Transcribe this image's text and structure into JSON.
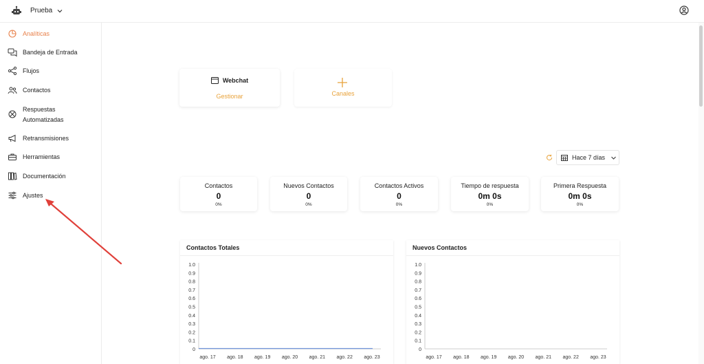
{
  "topbar": {
    "workspace_name": "Prueba",
    "logo_icon": "robot-icon",
    "user_icon": "user-circle-icon"
  },
  "sidebar": {
    "items": [
      {
        "label": "Analíticas",
        "icon": "analytics-icon",
        "active": true
      },
      {
        "label": "Bandeja de Entrada",
        "icon": "chat-bubbles-icon"
      },
      {
        "label": "Flujos",
        "icon": "flow-icon"
      },
      {
        "label": "Contactos",
        "icon": "contacts-icon"
      },
      {
        "label": "Respuestas Automatizadas",
        "icon": "auto-reply-icon"
      },
      {
        "label": "Retransmisiones",
        "icon": "megaphone-icon"
      },
      {
        "label": "Herramientas",
        "icon": "toolbox-icon"
      },
      {
        "label": "Documentación",
        "icon": "books-icon"
      },
      {
        "label": "Ajustes",
        "icon": "sliders-icon"
      }
    ]
  },
  "channels": {
    "webchat": {
      "title": "Webchat",
      "action": "Gestionar"
    },
    "add": {
      "label": "Canales"
    }
  },
  "filter": {
    "range": "Hace 7 días"
  },
  "stats": [
    {
      "label": "Contactos",
      "value": "0",
      "pct": "0%"
    },
    {
      "label": "Nuevos Contactos",
      "value": "0",
      "pct": "0%"
    },
    {
      "label": "Contactos Activos",
      "value": "0",
      "pct": "0%"
    },
    {
      "label": "Tiempo de respuesta",
      "value": "0m 0s",
      "pct": "0%"
    },
    {
      "label": "Primera Respuesta",
      "value": "0m 0s",
      "pct": "0%"
    }
  ],
  "colors": {
    "accent": "#e8804a",
    "link": "#e8a23a",
    "line": "#6f93d8",
    "arrow": "#e0403a"
  },
  "chart_data": [
    {
      "type": "line",
      "title": "Contactos Totales",
      "x": [
        "ago. 17",
        "ago. 18",
        "ago. 19",
        "ago. 20",
        "ago. 21",
        "ago. 22",
        "ago. 23"
      ],
      "series": [
        {
          "values": [
            0,
            0,
            0,
            0,
            0,
            0,
            0
          ]
        }
      ],
      "yticks": [
        "0",
        "0.1",
        "0.2",
        "0.3",
        "0.4",
        "0.5",
        "0.6",
        "0.7",
        "0.8",
        "0.9",
        "1.0"
      ],
      "ylim": [
        0,
        1
      ]
    },
    {
      "type": "line",
      "title": "Nuevos Contactos",
      "x": [
        "ago. 17",
        "ago. 18",
        "ago. 19",
        "ago. 20",
        "ago. 21",
        "ago. 22",
        "ago. 23"
      ],
      "series": [
        {
          "values": []
        }
      ],
      "yticks": [
        "0",
        "0.1",
        "0.2",
        "0.3",
        "0.4",
        "0.5",
        "0.6",
        "0.7",
        "0.8",
        "0.9",
        "1.0"
      ],
      "ylim": [
        0,
        1
      ]
    }
  ]
}
